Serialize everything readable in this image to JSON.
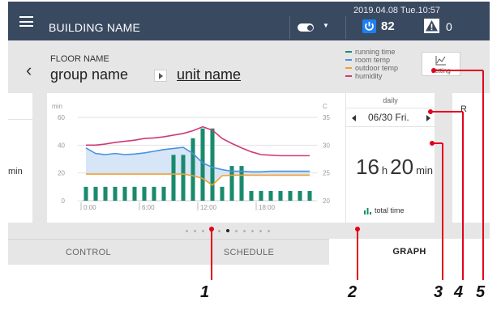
{
  "header": {
    "building_name": "BUILDING NAME",
    "datetime": "2019.04.08 Tue.10:57",
    "power_count": "82",
    "alert_count": "0",
    "icons": [
      "menu-icon",
      "toggle-icon",
      "power-icon",
      "alert-icon"
    ]
  },
  "floor": {
    "floor_name": "FLOOR NAME",
    "group_name": "group name",
    "unit_name": "unit name"
  },
  "legend": [
    {
      "label": "running time",
      "color": "#1a8a6e"
    },
    {
      "label": "room temp",
      "color": "#4a90e2"
    },
    {
      "label": "outdoor temp",
      "color": "#f0a030"
    },
    {
      "label": "humidity",
      "color": "#d0387a"
    }
  ],
  "setting": {
    "label": "setting"
  },
  "left_card": {
    "value": "min"
  },
  "right_card": {
    "label": "R"
  },
  "chart_data": {
    "type": "bar",
    "left_axis_label": "min",
    "right_axis_label": "C",
    "left_ylim": [
      0,
      60
    ],
    "left_ticks": [
      "0",
      "20",
      "40",
      "60"
    ],
    "right_ylim": [
      20,
      35
    ],
    "right_ticks": [
      "20",
      "25",
      "30",
      "35"
    ],
    "x_labels": [
      "0:00",
      "6:00",
      "12:00",
      "18:00"
    ],
    "categories": [
      "0",
      "1",
      "2",
      "3",
      "4",
      "5",
      "6",
      "7",
      "8",
      "9",
      "10",
      "11",
      "12",
      "13",
      "14",
      "15",
      "16",
      "17",
      "18",
      "19",
      "20",
      "21",
      "22",
      "23"
    ],
    "series": [
      {
        "name": "running time",
        "color": "#1a8a6e",
        "axis": "left",
        "values": [
          10,
          10,
          10,
          10,
          10,
          10,
          10,
          10,
          10,
          33,
          33,
          45,
          52,
          52,
          10,
          25,
          25,
          7,
          7,
          7,
          7,
          7,
          7,
          7
        ]
      },
      {
        "name": "room temp",
        "color": "#4a90e2",
        "axis": "right",
        "values": [
          29.5,
          28.5,
          28.3,
          28.5,
          28.3,
          28.4,
          28.6,
          28.9,
          29.2,
          29.4,
          29.6,
          28.5,
          26.8,
          26.0,
          25.6,
          25.3,
          25.3,
          25.2,
          25.2,
          25.3,
          25.3,
          25.3,
          25.3,
          25.3
        ]
      },
      {
        "name": "outdoor temp",
        "color": "#f0a030",
        "axis": "right",
        "values": [
          24.8,
          24.8,
          24.8,
          24.8,
          24.8,
          24.8,
          24.8,
          24.8,
          24.8,
          24.8,
          24.8,
          24.5,
          24.0,
          22.8,
          24.5,
          24.6,
          24.6,
          24.6,
          24.6,
          24.6,
          24.6,
          24.6,
          24.6,
          24.6
        ]
      },
      {
        "name": "humidity",
        "color": "#d0387a",
        "axis": "right",
        "values": [
          30.0,
          30.0,
          30.2,
          30.5,
          30.7,
          30.9,
          31.2,
          31.3,
          31.5,
          31.8,
          32.1,
          32.6,
          33.3,
          32.7,
          31.2,
          30.3,
          29.5,
          28.8,
          28.3,
          28.2,
          28.1,
          28.1,
          28.1,
          28.1
        ]
      }
    ]
  },
  "daily": {
    "label": "daily",
    "date": "06/30 Fri.",
    "hours": "16",
    "hours_unit": "h",
    "minutes": "20",
    "minutes_unit": "min",
    "total_label": "total time"
  },
  "pager": {
    "count": 11,
    "active_index": 5
  },
  "tabs": [
    {
      "label": "CONTROL",
      "active": false
    },
    {
      "label": "SCHEDULE",
      "active": false
    },
    {
      "label": "GRAPH",
      "active": true
    }
  ],
  "callouts": [
    "1",
    "2",
    "3",
    "4",
    "5"
  ]
}
